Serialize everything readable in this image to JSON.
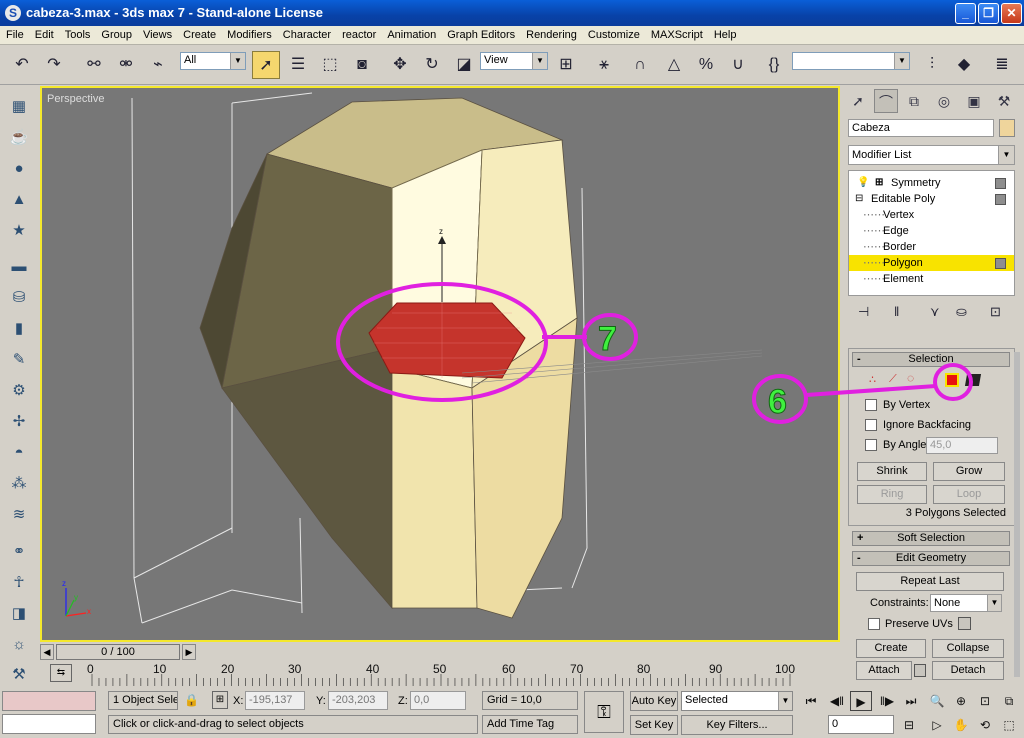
{
  "window": {
    "title": "cabeza-3.max - 3ds max 7 - Stand-alone License",
    "app_icon": "S",
    "controls": [
      "_",
      "❐",
      "✕"
    ]
  },
  "menu": [
    "File",
    "Edit",
    "Tools",
    "Group",
    "Views",
    "Create",
    "Modifiers",
    "Character",
    "reactor",
    "Animation",
    "Graph Editors",
    "Rendering",
    "Customize",
    "MAXScript",
    "Help"
  ],
  "toolbar": {
    "selection_filter": "All",
    "ref_coord": "View",
    "named_selection": ""
  },
  "viewport": {
    "label": "Perspective",
    "gizmo_axis_label": "z",
    "axis_labels": [
      "x",
      "y",
      "z"
    ],
    "highlight_color": "#c5342c",
    "border_color": "#f4e82c"
  },
  "callouts": {
    "seven": "7",
    "six": "6",
    "ring_color": "#e020e0",
    "number_color": "#3ff03f"
  },
  "command_panel": {
    "object_name": "Cabeza",
    "object_color": "#efd59c",
    "modifier_list": "Modifier List",
    "stack": [
      {
        "label": "Symmetry",
        "indent": 0
      },
      {
        "label": "Editable Poly",
        "indent": 0
      },
      {
        "label": "Vertex",
        "indent": 1
      },
      {
        "label": "Edge",
        "indent": 1
      },
      {
        "label": "Border",
        "indent": 1
      },
      {
        "label": "Polygon",
        "indent": 1
      },
      {
        "label": "Element",
        "indent": 1
      }
    ],
    "selection": {
      "title": "Selection",
      "by_vertex": "By Vertex",
      "ignore_backfacing": "Ignore Backfacing",
      "by_angle": "By Angle:",
      "angle_value": "45,0",
      "shrink": "Shrink",
      "grow": "Grow",
      "ring": "Ring",
      "loop": "Loop",
      "status": "3 Polygons Selected"
    },
    "soft_selection": "Soft Selection",
    "edit_geometry": {
      "title": "Edit Geometry",
      "repeat_last": "Repeat Last",
      "constraints_label": "Constraints:",
      "constraints_value": "None",
      "preserve_uvs": "Preserve UVs",
      "create": "Create",
      "collapse": "Collapse",
      "attach": "Attach",
      "detach": "Detach"
    }
  },
  "timeline": {
    "slider": "0 / 100",
    "ticks": [
      "0",
      "10",
      "20",
      "30",
      "40",
      "50",
      "60",
      "70",
      "80",
      "90",
      "100"
    ]
  },
  "statusbar": {
    "objects_selected": "1 Object Sele",
    "x_label": "X:",
    "x_value": "-195,137",
    "y_label": "Y:",
    "y_value": "-203,203",
    "z_label": "Z:",
    "z_value": "0,0",
    "grid": "Grid = 10,0",
    "prompt": "Click or click-and-drag to select objects",
    "add_time_tag": "Add Time Tag",
    "auto_key": "Auto Key",
    "set_key": "Set Key",
    "key_mode": "Selected",
    "key_filters": "Key Filters...",
    "frame": "0"
  }
}
